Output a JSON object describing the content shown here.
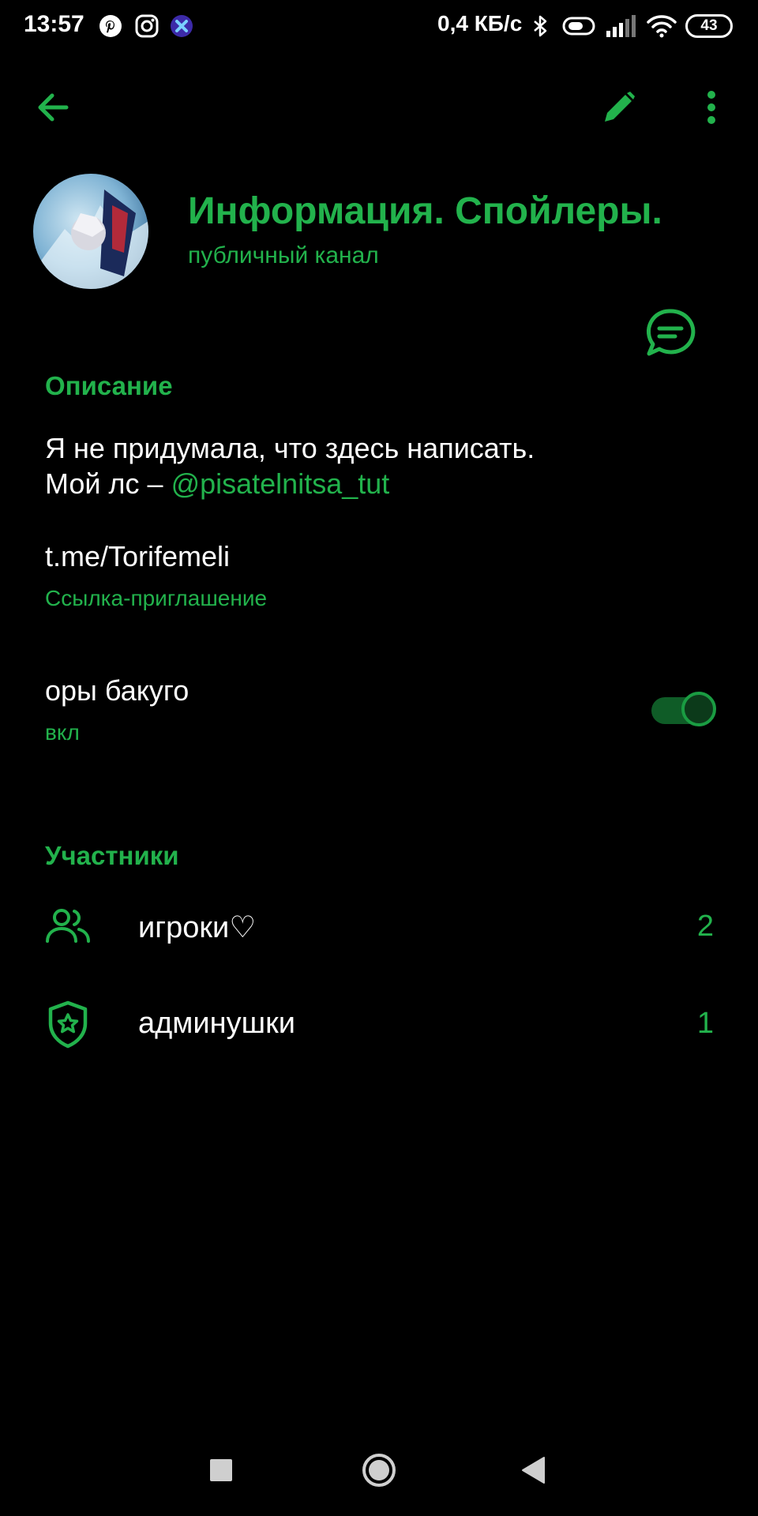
{
  "status_bar": {
    "time": "13:57",
    "network_speed": "0,4 КБ/с",
    "battery": "43",
    "icons": [
      "pinterest-icon",
      "instagram-icon",
      "app-icon",
      "bluetooth-icon",
      "alarm-icon",
      "signal-icon",
      "wifi-icon",
      "battery-icon"
    ]
  },
  "toolbar": {
    "icons": [
      "back-arrow-icon",
      "edit-pencil-icon",
      "more-vert-icon"
    ]
  },
  "header": {
    "title": "Информация. Спойлеры.",
    "subtitle": "публичный канал"
  },
  "description": {
    "section_title": "Описание",
    "line1": "Я не придумала, что здесь написать.",
    "line2_prefix": "Мой лс – ",
    "mention": "@pisatelnitsa_tut"
  },
  "invite": {
    "link": "t.me/Torifemeli",
    "label": "Ссылка-приглашение"
  },
  "setting": {
    "title": "оры бакуго",
    "state": "вкл",
    "toggled": true
  },
  "members": {
    "section_title": "Участники",
    "rows": [
      {
        "label": "игроки♡",
        "count": "2",
        "icon": "people-icon"
      },
      {
        "label": "админушки",
        "count": "1",
        "icon": "admin-shield-icon"
      }
    ]
  },
  "colors": {
    "accent": "#22b24c",
    "background": "#000000",
    "text": "#ffffff"
  }
}
